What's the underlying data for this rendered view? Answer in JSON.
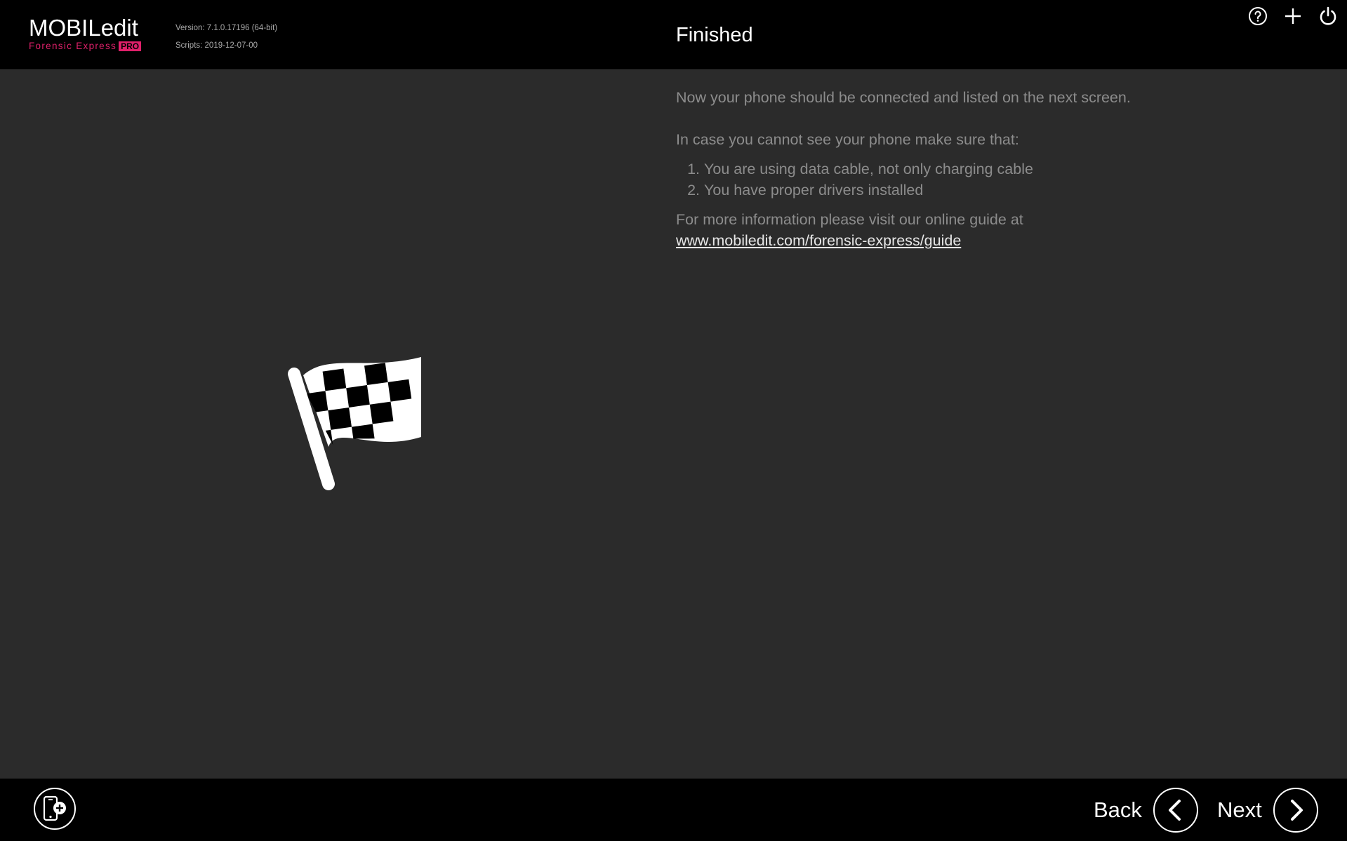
{
  "app": {
    "logo_title": "MOBILedit",
    "logo_subtitle": "Forensic Express",
    "logo_badge": "PRO",
    "version": "Version: 7.1.0.17196 (64-bit)",
    "scripts": "Scripts: 2019-12-07-00",
    "accent_color": "#e0206a"
  },
  "header": {
    "title": "Finished",
    "icons": [
      "help-icon",
      "minimize-icon",
      "power-icon"
    ]
  },
  "main": {
    "intro": "Now your phone should be connected and listed on the next screen.",
    "checklist_heading": "In case you cannot see your phone make sure that:",
    "checklist": [
      "You are using data cable, not only charging cable",
      "You have proper drivers installed"
    ],
    "more_info": "For more information please visit our online guide at",
    "guide_link": "www.mobiledit.com/forensic-express/guide",
    "illustration_icon": "checkered-flag-icon"
  },
  "footer": {
    "add_device_icon": "add-device-icon",
    "back_label": "Back",
    "next_label": "Next"
  }
}
